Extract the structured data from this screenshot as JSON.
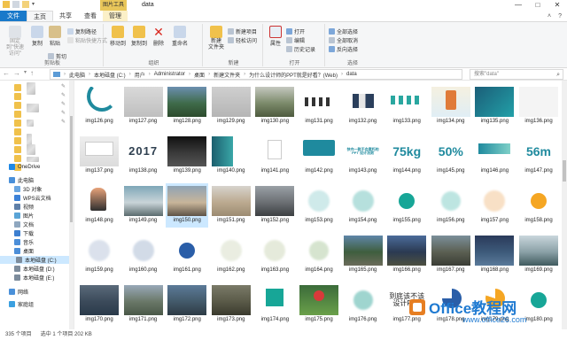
{
  "window": {
    "context_tab": "图片工具",
    "title": "data",
    "buttons": [
      "—",
      "□",
      "✕"
    ]
  },
  "tabs": [
    {
      "label": "文件"
    },
    {
      "label": "主页"
    },
    {
      "label": "共享"
    },
    {
      "label": "查看"
    },
    {
      "label": "管理"
    }
  ],
  "ribbon": {
    "clipboard": {
      "pin": "固定到\"快速访问\"",
      "copy": "复制",
      "paste": "粘贴",
      "cut": "剪切",
      "copy_path": "复制路径",
      "paste_shortcut": "粘贴快捷方式",
      "label": "剪贴板"
    },
    "organize": {
      "move_to": "移动到",
      "copy_to": "复制到",
      "delete": "删除",
      "rename": "重命名",
      "label": "组织"
    },
    "new": {
      "new_folder": "新建\n文件夹",
      "new_item": "新建项目",
      "easy_access": "轻松访问",
      "label": "新建"
    },
    "open": {
      "properties": "属性",
      "open": "打开",
      "edit": "编辑",
      "history": "历史记录",
      "label": "打开"
    },
    "select": {
      "select_all": "全部选择",
      "select_none": "全部取消",
      "invert": "反向选择",
      "label": "选择"
    }
  },
  "address": {
    "path": [
      "此电脑",
      "本地磁盘 (C:)",
      "用户",
      "Administrator",
      "桌面",
      "新建文件夹",
      "为什么设计师的PPT就是好看？(Web)",
      "data"
    ],
    "search_placeholder": "搜索\"data\""
  },
  "nav": {
    "items": [
      {
        "label": "OneDrive"
      },
      {
        "label": "此电脑"
      },
      {
        "label": "3D 对象"
      },
      {
        "label": "WPS云文档"
      },
      {
        "label": "视频"
      },
      {
        "label": "图片"
      },
      {
        "label": "文档"
      },
      {
        "label": "下载"
      },
      {
        "label": "音乐"
      },
      {
        "label": "桌面"
      },
      {
        "label": "本地磁盘 (C:)"
      },
      {
        "label": "本地磁盘 (D:)"
      },
      {
        "label": "本地磁盘 (E:)"
      },
      {
        "label": "网络"
      },
      {
        "label": "家庭组"
      }
    ]
  },
  "files": [
    "img126.png",
    "img127.png",
    "img128.png",
    "img129.png",
    "img130.png",
    "img131.png",
    "img132.png",
    "img133.png",
    "img134.png",
    "img135.png",
    "img136.png",
    "img137.png",
    "img138.png",
    "img139.png",
    "img140.png",
    "img141.png",
    "img142.png",
    "img143.png",
    "img144.png",
    "img145.png",
    "img146.png",
    "img147.png",
    "img148.png",
    "img149.png",
    "img150.png",
    "img151.png",
    "img152.png",
    "img153.png",
    "img154.png",
    "img155.png",
    "img156.png",
    "img157.png",
    "img158.png",
    "img159.png",
    "img160.png",
    "img161.png",
    "img162.png",
    "img163.png",
    "img164.png",
    "img165.png",
    "img166.png",
    "img167.png",
    "img168.png",
    "img169.png",
    "img170.png",
    "img171.png",
    "img172.png",
    "img173.png",
    "img174.png",
    "img175.png",
    "img176.png",
    "img177.png",
    "img178.png",
    "img179.png",
    "img180.png"
  ],
  "thumb_text": {
    "t138": "2017",
    "t143": "快充一款不会腐朽的 PPT 设计法则",
    "t144": "75kg",
    "t145": "50%",
    "t147": "56m",
    "t177": "到底该不该\n设计PPT"
  },
  "status": {
    "count": "335 个项目",
    "selected": "选中 1 个项目  202 KB"
  },
  "watermark": {
    "brand": "Office教程网",
    "url": "www.office26.com"
  },
  "colors": {
    "file_tab": "#1979ca",
    "context_tab": "#e8c65a",
    "selection": "#cce8ff",
    "teal": "#17a697",
    "orange": "#f5a623"
  }
}
